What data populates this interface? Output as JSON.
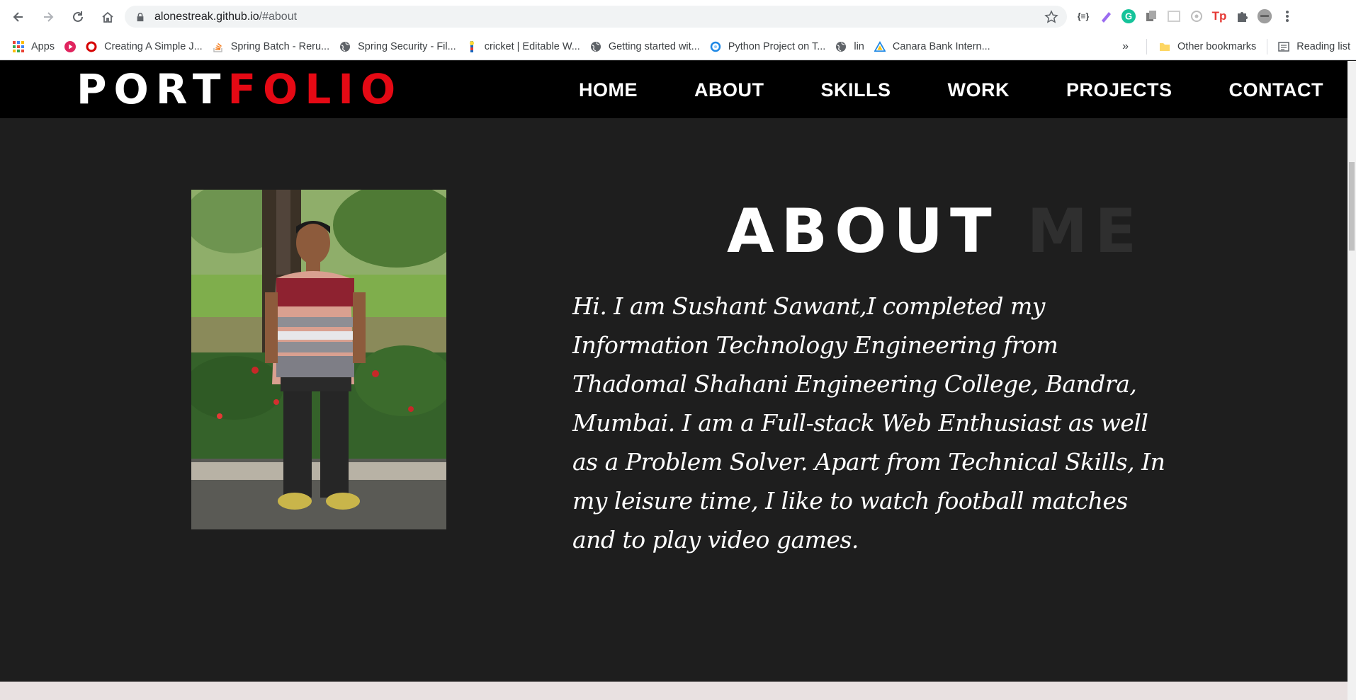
{
  "browser": {
    "url_host": "alonestreak.github.io",
    "url_path": "/#about",
    "bookmarks": [
      {
        "label": "Apps",
        "icon": "apps-grid-icon"
      },
      {
        "label": "",
        "icon": "play-icon"
      },
      {
        "label": "Creating A Simple J...",
        "icon": "opera-icon"
      },
      {
        "label": "Spring Batch - Reru...",
        "icon": "stackoverflow-icon"
      },
      {
        "label": "Spring Security - Fil...",
        "icon": "globe-icon"
      },
      {
        "label": "cricket | Editable W...",
        "icon": "cricket-icon"
      },
      {
        "label": "Getting started wit...",
        "icon": "globe-icon"
      },
      {
        "label": "Python Project on T...",
        "icon": "python-icon"
      },
      {
        "label": "lin",
        "icon": "globe-icon"
      },
      {
        "label": "Canara Bank Intern...",
        "icon": "triangle-icon"
      }
    ],
    "overflow_label": "»",
    "other_bookmarks": "Other bookmarks",
    "reading_list": "Reading list"
  },
  "site": {
    "logo_part1": "PORT",
    "logo_part2": "FOLIO",
    "menu": [
      "HOME",
      "ABOUT",
      "SKILLS",
      "WORK",
      "PROJECTS",
      "CONTACT"
    ]
  },
  "about": {
    "heading_part1": "ABOUT",
    "heading_part2": "ME",
    "bio": "Hi. I am Sushant Sawant,I completed my Information Technology Engineering from Thadomal Shahani Engineering College, Bandra, Mumbai. I am a Full-stack Web Enthusiast as well as a Problem Solver. Apart from Technical Skills, In my leisure time, I like to watch football matches and to play video games."
  },
  "colors": {
    "accent_red": "#e50914",
    "page_bg": "#1e1e1e",
    "nav_bg": "#000000"
  }
}
